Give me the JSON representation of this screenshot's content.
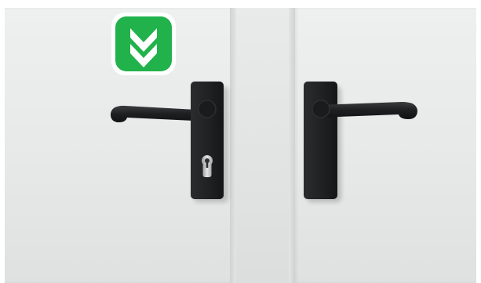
{
  "scene": {
    "subject": "pair-of-door-handles",
    "colors": {
      "door": "#e8eaea",
      "handle": "#1d1f21",
      "badge_green": "#21b24b",
      "badge_border": "#ffffff",
      "keyhole_metal": "#c9cccc"
    }
  },
  "overlay_icon": {
    "icon": "double-chevron-down-icon",
    "color": "#21b24b"
  }
}
